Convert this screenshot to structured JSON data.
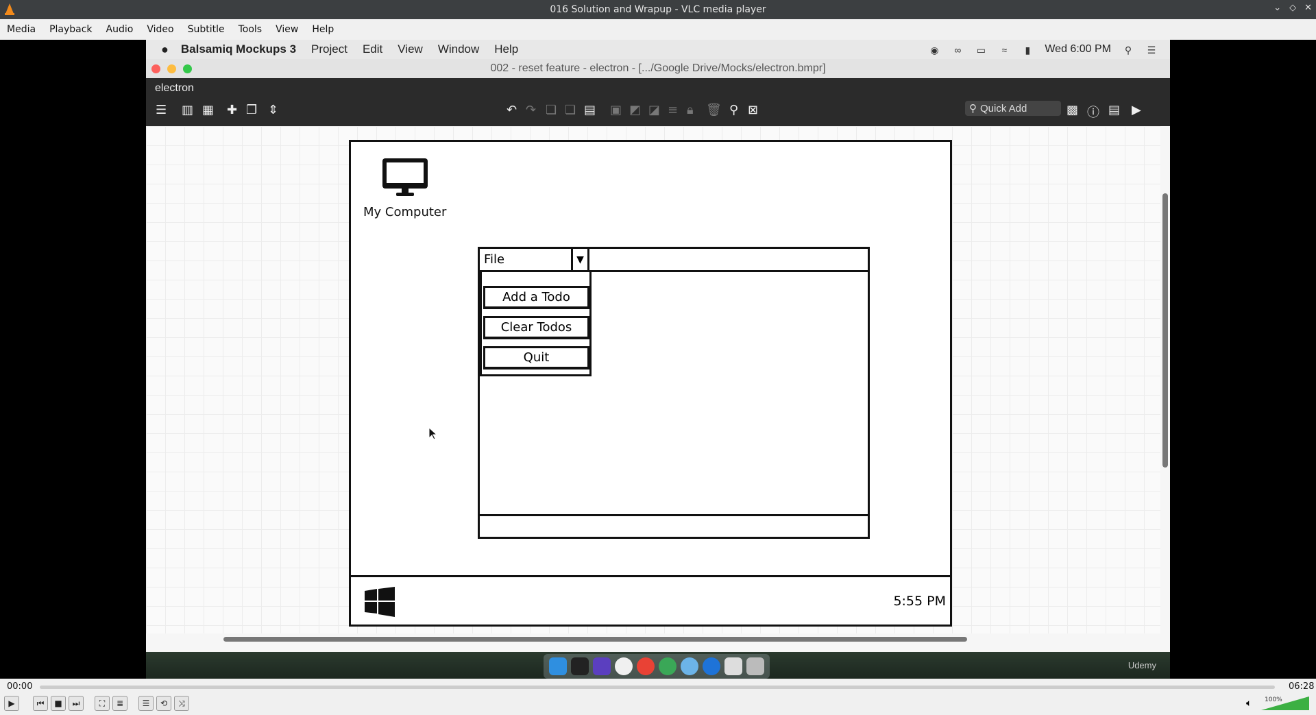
{
  "vlc": {
    "window_title": "016 Solution and Wrapup - VLC media player",
    "menu": [
      "Media",
      "Playback",
      "Audio",
      "Video",
      "Subtitle",
      "Tools",
      "View",
      "Help"
    ],
    "time_current": "00:00",
    "time_total": "06:28",
    "volume_label": "100%"
  },
  "mac": {
    "app_name": "Balsamiq Mockups 3",
    "menu": [
      "Project",
      "Edit",
      "View",
      "Window",
      "Help"
    ],
    "clock": "Wed 6:00 PM"
  },
  "balsamiq": {
    "window_title": "002 - reset feature - electron - [.../Google Drive/Mocks/electron.bmpr]",
    "project_name": "electron",
    "quick_add_placeholder": "Quick Add"
  },
  "mock": {
    "desktop_icon_label": "My Computer",
    "file_menu_label": "File",
    "menu_items": [
      "Add a Todo",
      "Clear Todos",
      "Quit"
    ],
    "taskbar_clock": "5:55 PM"
  },
  "dock": {
    "brand": "Udemy"
  }
}
